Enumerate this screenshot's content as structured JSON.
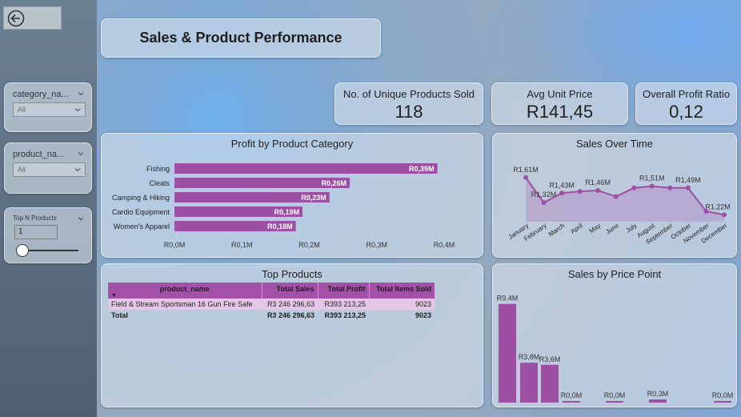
{
  "title": "Sales & Product Performance",
  "slicers": {
    "category": {
      "title": "category_na...",
      "value": "All"
    },
    "product": {
      "title": "product_na...",
      "value": "All"
    },
    "topn": {
      "title": "Top N Products",
      "value": "1"
    }
  },
  "kpis": [
    {
      "label": "No. of Unique Products Sold",
      "value": "118"
    },
    {
      "label": "Avg Unit Price",
      "value": "R141,45"
    },
    {
      "label": "Overall Profit Ratio",
      "value": "0,12"
    }
  ],
  "colors": {
    "accent": "#9c4fa3",
    "accent_light": "#e4c6e6"
  },
  "profit_by_category": {
    "title": "Profit by Product Category",
    "chart_data": {
      "type": "bar",
      "orientation": "horizontal",
      "categories": [
        "Fishing",
        "Cleats",
        "Camping & Hiking",
        "Cardio Equipment",
        "Women's Apparel"
      ],
      "values": [
        0.39,
        0.26,
        0.23,
        0.19,
        0.18
      ],
      "data_labels": [
        "R0,39M",
        "R0,26M",
        "R0,23M",
        "R0,19M",
        "R0,18M"
      ],
      "xticks": [
        "R0,0M",
        "R0,1M",
        "R0,2M",
        "R0,3M",
        "R0,4M"
      ],
      "xlim": [
        0,
        0.4
      ]
    }
  },
  "sales_over_time": {
    "title": "Sales Over Time",
    "chart_data": {
      "type": "area",
      "categories": [
        "January",
        "February",
        "March",
        "April",
        "May",
        "June",
        "July",
        "August",
        "September",
        "October",
        "November",
        "December"
      ],
      "values": [
        1.61,
        1.32,
        1.43,
        1.45,
        1.46,
        1.39,
        1.49,
        1.51,
        1.49,
        1.49,
        1.22,
        1.18
      ],
      "data_labels": [
        "R1,61M",
        "R1,32M",
        "R1,43M",
        "",
        "R1,46M",
        "",
        "",
        "R1,51M",
        "",
        "R1,49M",
        "",
        "R1,22M"
      ]
    }
  },
  "top_products": {
    "title": "Top Products",
    "columns": [
      "product_name",
      "Total Sales",
      "Total Profit",
      "Total Items Sold"
    ],
    "rows": [
      [
        "Field & Stream Sportsman 16 Gun Fire Safe",
        "R3 246 296,63",
        "R393 213,25",
        "9023"
      ]
    ],
    "total": [
      "Total",
      "R3 246 296,63",
      "R393 213,25",
      "9023"
    ]
  },
  "sales_by_price_point": {
    "title": "Sales by Price Point",
    "chart_data": {
      "type": "bar",
      "values": [
        9.4,
        3.8,
        3.6,
        0.0,
        0.0,
        0.3,
        0.0
      ],
      "data_labels": [
        "R9,4M",
        "R3,8M",
        "R3,6M",
        "R0,0M",
        "R0,0M",
        "R0,3M",
        "R0,0M"
      ],
      "ylim": [
        0,
        10
      ]
    }
  }
}
